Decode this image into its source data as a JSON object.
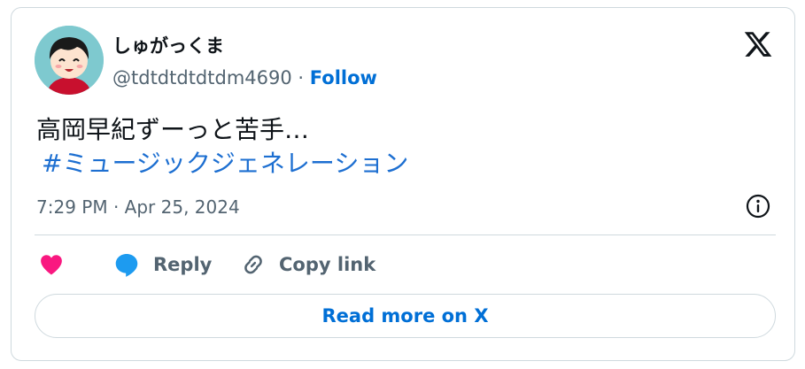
{
  "author": {
    "display_name": "しゅがっくま",
    "handle": "@tdtdtdtdtdm4690",
    "separator": "·",
    "follow_label": "Follow"
  },
  "tweet": {
    "text": "高岡早紀ずーっと苦手…",
    "hashtag": "#ミュージックジェネレーション",
    "timestamp": "7:29 PM · Apr 25, 2024"
  },
  "actions": {
    "like_icon": "heart-icon",
    "reply_label": "Reply",
    "copy_link_label": "Copy link"
  },
  "footer": {
    "read_more_label": "Read more on X"
  },
  "colors": {
    "link_blue": "#006fd6",
    "hashtag_blue": "#1d6fd1",
    "heart_pink": "#f91880",
    "reply_blue": "#1d9bf0",
    "muted_gray": "#536471",
    "border": "#cfd9de"
  }
}
